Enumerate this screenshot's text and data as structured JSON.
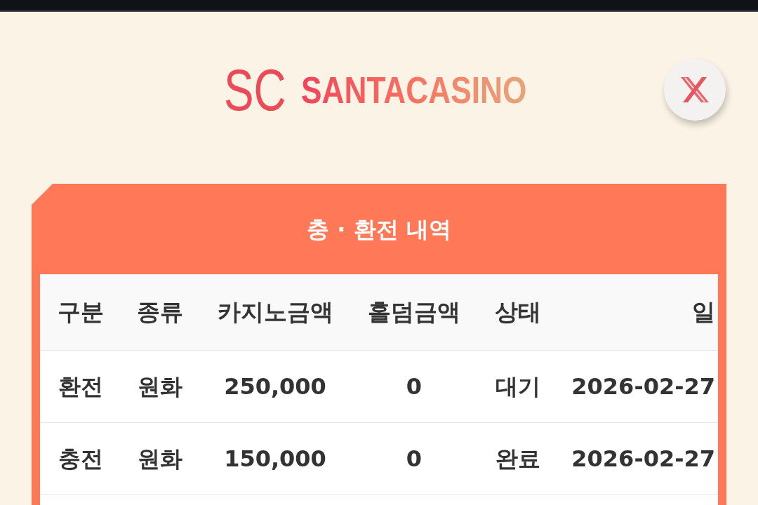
{
  "logo": {
    "mark": "SC",
    "wordmark": "SANTACASINO"
  },
  "panel": {
    "title": "충 · 환전 내역"
  },
  "table": {
    "columns": [
      "구분",
      "종류",
      "카지노금액",
      "홀덤금액",
      "상태",
      "일"
    ],
    "rows": [
      [
        "환전",
        "원화",
        "250,000",
        "0",
        "대기",
        "2026-02-27"
      ],
      [
        "충전",
        "원화",
        "150,000",
        "0",
        "완료",
        "2026-02-27"
      ]
    ]
  }
}
